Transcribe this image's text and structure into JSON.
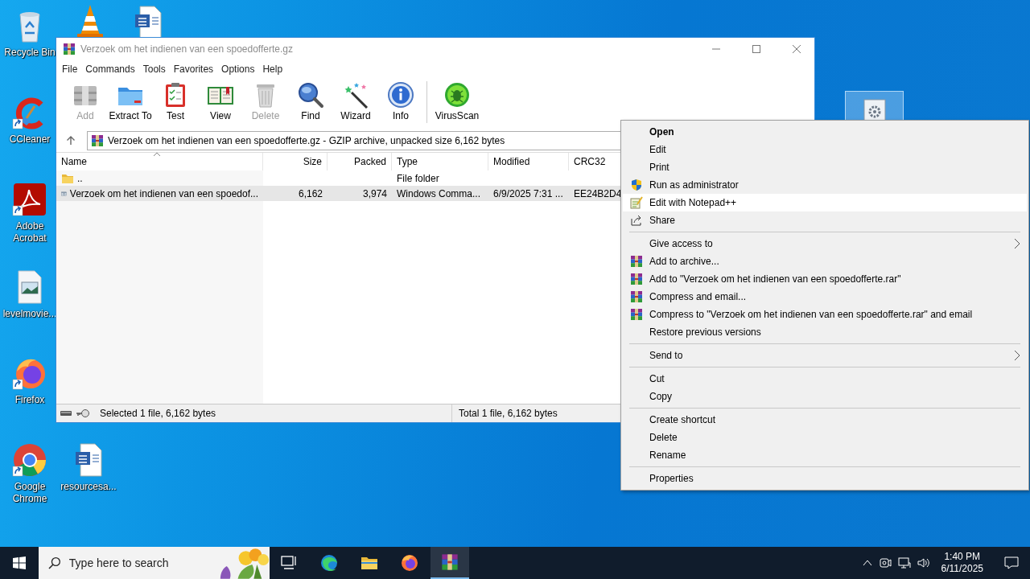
{
  "desktop": {
    "icons": [
      {
        "label": "Recycle Bin"
      },
      {
        "label": "CCleaner"
      },
      {
        "label": "Adobe Acrobat"
      },
      {
        "label": "levelmovie..."
      },
      {
        "label": "Firefox"
      },
      {
        "label": "Google Chrome"
      },
      {
        "label": "resourcesa..."
      }
    ]
  },
  "window": {
    "title": "Verzoek om het indienen van een spoedofferte.gz",
    "menu": [
      "File",
      "Commands",
      "Tools",
      "Favorites",
      "Options",
      "Help"
    ],
    "toolbar": [
      {
        "label": "Add",
        "disabled": true
      },
      {
        "label": "Extract To",
        "disabled": false
      },
      {
        "label": "Test",
        "disabled": false
      },
      {
        "label": "View",
        "disabled": false
      },
      {
        "label": "Delete",
        "disabled": true
      },
      {
        "label": "Find",
        "disabled": false
      },
      {
        "label": "Wizard",
        "disabled": false
      },
      {
        "label": "Info",
        "disabled": false
      },
      {
        "label": "VirusScan",
        "disabled": false
      }
    ],
    "address": "Verzoek om het indienen van een spoedofferte.gz - GZIP archive, unpacked size 6,162 bytes",
    "columns": [
      "Name",
      "Size",
      "Packed",
      "Type",
      "Modified",
      "CRC32"
    ],
    "rows": [
      {
        "kind": "folder",
        "selected": false,
        "name": "..",
        "type": "File folder"
      },
      {
        "kind": "file",
        "selected": true,
        "name": "Verzoek om het indienen van een spoedof...",
        "size": "6,162",
        "packed": "3,974",
        "type": "Windows Comma...",
        "modified": "6/9/2025 7:31 ...",
        "crc32": "EE24B2D4"
      }
    ],
    "status": {
      "selected": "Selected 1 file, 6,162 bytes",
      "total": "Total 1 file, 6,162 bytes"
    }
  },
  "context_menu": {
    "sections": [
      [
        {
          "label": "Open",
          "default": true,
          "selected": false,
          "submenu": false
        },
        {
          "label": "Edit",
          "default": false,
          "selected": false,
          "submenu": false
        },
        {
          "label": "Print",
          "default": false,
          "selected": false,
          "submenu": false
        },
        {
          "label": "Run as administrator",
          "default": false,
          "selected": false,
          "submenu": false
        },
        {
          "label": "Edit with Notepad++",
          "default": false,
          "selected": true,
          "submenu": false
        },
        {
          "label": "Share",
          "default": false,
          "selected": false,
          "submenu": false
        }
      ],
      [
        {
          "label": "Give access to",
          "default": false,
          "selected": false,
          "submenu": true
        },
        {
          "label": "Add to archive...",
          "default": false,
          "selected": false,
          "submenu": false
        },
        {
          "label": "Add to \"Verzoek om het indienen van een spoedofferte.rar\"",
          "default": false,
          "selected": false,
          "submenu": false
        },
        {
          "label": "Compress and email...",
          "default": false,
          "selected": false,
          "submenu": false
        },
        {
          "label": "Compress to \"Verzoek om het indienen van een spoedofferte.rar\" and email",
          "default": false,
          "selected": false,
          "submenu": false
        },
        {
          "label": "Restore previous versions",
          "default": false,
          "selected": false,
          "submenu": false
        }
      ],
      [
        {
          "label": "Send to",
          "default": false,
          "selected": false,
          "submenu": true
        }
      ],
      [
        {
          "label": "Cut",
          "default": false,
          "selected": false,
          "submenu": false
        },
        {
          "label": "Copy",
          "default": false,
          "selected": false,
          "submenu": false
        }
      ],
      [
        {
          "label": "Create shortcut",
          "default": false,
          "selected": false,
          "submenu": false
        },
        {
          "label": "Delete",
          "default": false,
          "selected": false,
          "submenu": false
        },
        {
          "label": "Rename",
          "default": false,
          "selected": false,
          "submenu": false
        }
      ],
      [
        {
          "label": "Properties",
          "default": false,
          "selected": false,
          "submenu": false
        }
      ]
    ]
  },
  "taskbar": {
    "search": {
      "placeholder": "Type here to search"
    },
    "apps": [
      {
        "selected": false
      },
      {
        "selected": false
      },
      {
        "selected": false
      },
      {
        "selected": false
      },
      {
        "selected": true
      }
    ],
    "time": "1:40 PM",
    "date": "6/11/2025"
  }
}
